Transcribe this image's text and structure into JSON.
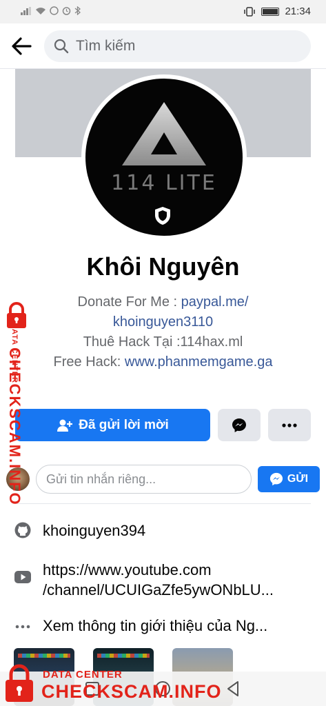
{
  "status_bar": {
    "time": "21:34"
  },
  "header": {
    "search_placeholder": "Tìm kiếm"
  },
  "profile": {
    "avatar_caption": "114 LITE",
    "name": "Khôi Nguyên",
    "bio": {
      "line1_prefix": "Donate For Me : ",
      "line1_link": "paypal.me/",
      "line2_link": "khoinguyen3110",
      "line3": "Thuê Hack Tại :114hax.ml",
      "line4_prefix": "Free Hack: ",
      "line4_link": "www.phanmemgame.ga"
    }
  },
  "actions": {
    "add_friend_label": "Đã gửi lời mời"
  },
  "message": {
    "input_placeholder": "Gửi tin nhắn riêng...",
    "send_label": "GỬI"
  },
  "info": {
    "github": "khoinguyen394",
    "youtube_line1": "https://www.youtube.com",
    "youtube_line2": "/channel/UCUIGaZfe5ywONbLU...",
    "about": "Xem thông tin giới thiệu của Ng..."
  },
  "watermark": {
    "sub": "DATA CENTER",
    "main": "CHECKSCAM.INFO"
  },
  "colors": {
    "accent": "#1877f2",
    "link": "#385898",
    "watermark": "#e2231a"
  },
  "icons": [
    "signal-icon",
    "wifi-icon",
    "vibrate-icon",
    "battery-icon",
    "back-arrow-icon",
    "search-icon",
    "shield-icon",
    "add-friend-icon",
    "messenger-icon",
    "more-icon",
    "github-icon",
    "youtube-icon",
    "ellipsis-icon",
    "lock-icon"
  ]
}
